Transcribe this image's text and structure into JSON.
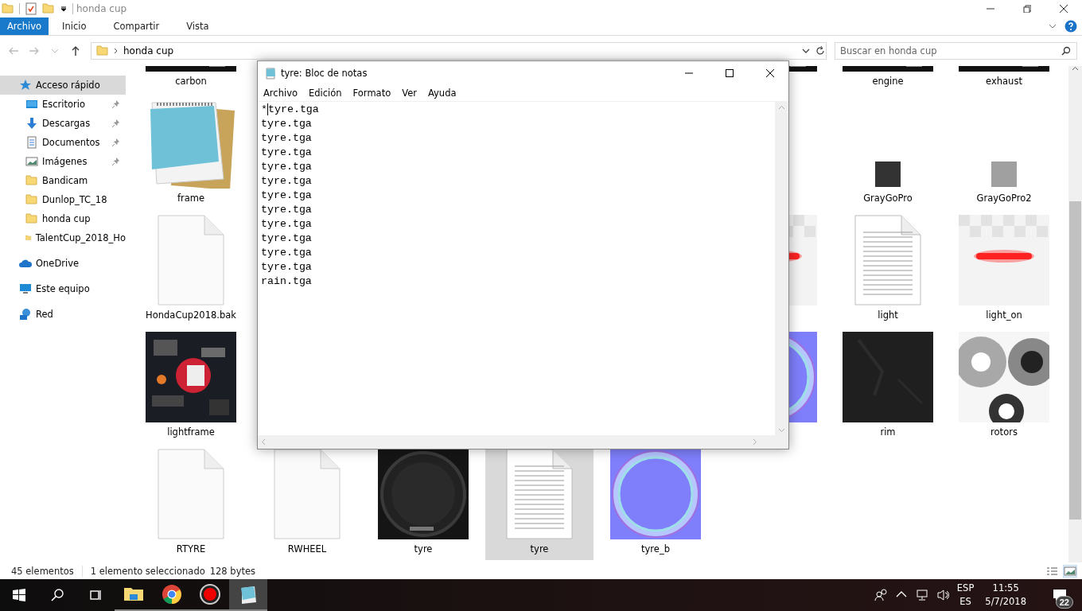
{
  "explorer": {
    "title": "honda cup",
    "ribbon_tabs": [
      {
        "label": "Archivo",
        "kind": "file"
      },
      {
        "label": "Inicio",
        "kind": "tab"
      },
      {
        "label": "Compartir",
        "kind": "tab"
      },
      {
        "label": "Vista",
        "kind": "tab"
      }
    ],
    "address": {
      "path": "honda cup"
    },
    "search": {
      "placeholder": "Buscar en honda cup"
    },
    "sidebar": {
      "items": [
        {
          "label": "Acceso rápido",
          "kind": "quick-access",
          "selected": true,
          "children": [
            {
              "label": "Escritorio",
              "kind": "desktop",
              "pinned": true,
              "selected": false
            },
            {
              "label": "Descargas",
              "kind": "downloads",
              "pinned": true,
              "selected": false
            },
            {
              "label": "Documentos",
              "kind": "documents",
              "pinned": true,
              "selected": false
            },
            {
              "label": "Imágenes",
              "kind": "pictures",
              "pinned": true,
              "selected": false
            },
            {
              "label": "Bandicam",
              "kind": "folder",
              "pinned": false,
              "selected": false
            },
            {
              "label": "Dunlop_TC_18",
              "kind": "folder",
              "pinned": false,
              "selected": false
            },
            {
              "label": "honda cup",
              "kind": "folder",
              "pinned": false,
              "selected": false
            },
            {
              "label": "TalentCup_2018_Ho",
              "kind": "folder",
              "pinned": false,
              "selected": false
            }
          ]
        },
        {
          "label": "OneDrive",
          "kind": "cloud",
          "selected": false
        },
        {
          "label": "Este equipo",
          "kind": "computer",
          "selected": false
        },
        {
          "label": "Red",
          "kind": "network",
          "selected": false
        }
      ]
    },
    "file_rows": [
      {
        "start": [
          {
            "name": "carbon",
            "kind": "strip",
            "selected": false
          }
        ],
        "end": [
          {
            "kind": "strip"
          },
          {
            "name": "engine",
            "kind": "strip",
            "selected": false
          },
          {
            "name": "exhaust",
            "kind": "strip",
            "selected": false
          }
        ]
      },
      {
        "start": [
          {
            "name": "frame",
            "kind": "notepad",
            "selected": false
          }
        ],
        "end": [
          {
            "name": "GrayGoPro",
            "kind": "swatch",
            "color": "#333333",
            "selected": false
          },
          {
            "name": "GrayGoPro2",
            "kind": "swatch",
            "color": "#a0a0a0",
            "selected": false
          }
        ]
      },
      {
        "start": [
          {
            "name": "HondaCup2018.bak",
            "kind": "blank-doc",
            "selected": false
          }
        ],
        "end": [
          {
            "kind": "glow"
          },
          {
            "name": "light",
            "kind": "text-doc",
            "selected": false
          },
          {
            "name": "light_on",
            "kind": "glow",
            "selected": false
          }
        ]
      },
      {
        "start": [
          {
            "name": "lightframe",
            "kind": "texture",
            "selected": false
          }
        ],
        "end": [
          {
            "kind": "ring"
          },
          {
            "name": "rim",
            "kind": "dark",
            "selected": false
          },
          {
            "name": "rotors",
            "kind": "rotors",
            "selected": false
          }
        ]
      },
      {
        "start": [
          {
            "name": "RTYRE",
            "kind": "blank-doc",
            "selected": false
          },
          {
            "name": "RWHEEL",
            "kind": "blank-doc",
            "selected": false
          },
          {
            "name": "tyre",
            "kind": "tyre",
            "selected": false
          },
          {
            "name": "tyre",
            "kind": "text-doc",
            "selected": true
          },
          {
            "name": "tyre_b",
            "kind": "ring",
            "selected": false
          }
        ]
      }
    ],
    "status_bar": {
      "count": "45 elementos",
      "selection": "1 elemento seleccionado",
      "size": "128 bytes"
    },
    "view_buttons": [
      {
        "kind": "details",
        "selected": false
      },
      {
        "kind": "large-icons",
        "selected": true
      }
    ]
  },
  "notepad": {
    "title": "tyre: Bloc de notas",
    "menu": [
      "Archivo",
      "Edición",
      "Formato",
      "Ver",
      "Ayuda"
    ],
    "lines": [
      "*tyre.tga",
      "tyre.tga",
      "tyre.tga",
      "tyre.tga",
      "tyre.tga",
      "tyre.tga",
      "tyre.tga",
      "tyre.tga",
      "tyre.tga",
      "tyre.tga",
      "tyre.tga",
      "tyre.tga",
      "rain.tga"
    ]
  },
  "taskbar": {
    "apps": [
      {
        "kind": "explorer",
        "active": false
      },
      {
        "kind": "chrome",
        "active": false
      },
      {
        "kind": "recorder",
        "active": false
      },
      {
        "kind": "notepad",
        "active": true
      }
    ],
    "tray": {
      "language": "ESP",
      "layout": "ES",
      "time": "11:55",
      "date": "5/7/2018",
      "notifications": "22"
    }
  }
}
